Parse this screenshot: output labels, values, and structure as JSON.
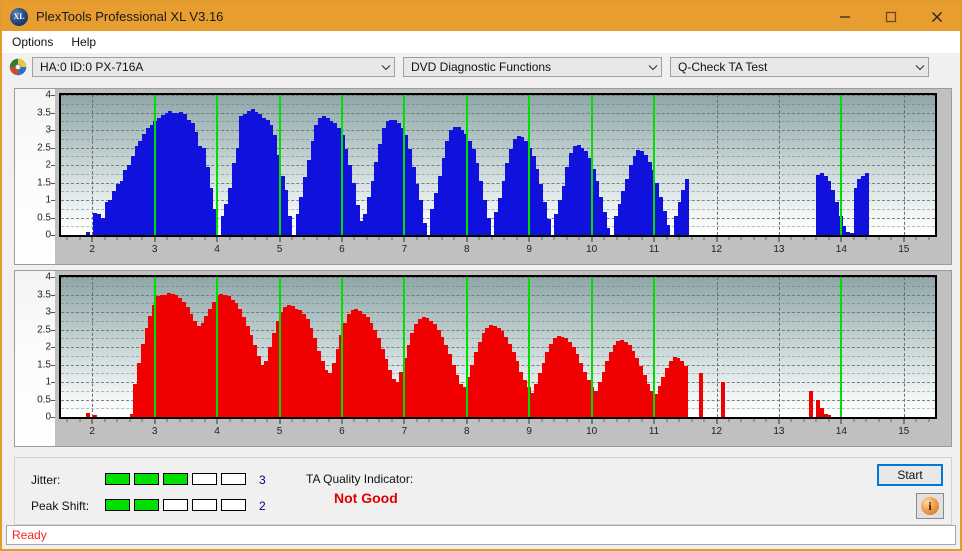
{
  "window": {
    "title": "PlexTools Professional XL V3.16",
    "icon": "XL",
    "controls": [
      {
        "name": "minimize",
        "glyph": "minimize-icon"
      },
      {
        "name": "maximize",
        "glyph": "maximize-icon"
      },
      {
        "name": "close",
        "glyph": "close-icon"
      }
    ],
    "titlebar_color": "#e89d31"
  },
  "menu": {
    "items": [
      {
        "label": "Options"
      },
      {
        "label": "Help"
      }
    ]
  },
  "toolbar": {
    "drive_icon": "disc-icon",
    "drive_select": {
      "value": "HA:0 ID:0  PX-716A",
      "arrow": "chevron-down-icon"
    },
    "function_select": {
      "value": "DVD Diagnostic Functions",
      "arrow": "chevron-down-icon"
    },
    "test_select": {
      "value": "Q-Check TA Test",
      "arrow": "chevron-down-icon"
    }
  },
  "results": {
    "jitter_label": "Jitter:",
    "jitter_value": "3",
    "jitter_filled": 3,
    "jitter_total": 5,
    "peak_shift_label": "Peak Shift:",
    "peak_shift_value": "2",
    "peak_shift_filled": 2,
    "peak_shift_total": 5,
    "ta_label": "TA Quality Indicator:",
    "ta_value": "Not Good",
    "ta_color": "#e00000",
    "meter_on_color": "#00e000",
    "start_label": "Start",
    "info_glyph": "i"
  },
  "status": {
    "text": "Ready",
    "color": "#ff2020"
  },
  "chart_data": [
    {
      "type": "bar",
      "name": "jitter-chart",
      "title": "",
      "xlabel": "",
      "ylabel": "",
      "xlim": [
        1.5,
        15.5
      ],
      "ylim": [
        0,
        4
      ],
      "ytick_labels": [
        "0",
        "0.5",
        "1",
        "1.5",
        "2",
        "2.5",
        "3",
        "3.5",
        "4"
      ],
      "ytick_values": [
        0,
        0.5,
        1,
        1.5,
        2,
        2.5,
        3,
        3.5,
        4
      ],
      "xtick_labels": [
        "2",
        "3",
        "4",
        "5",
        "6",
        "7",
        "8",
        "9",
        "10",
        "11",
        "12",
        "13",
        "14",
        "15"
      ],
      "xtick_values": [
        2,
        3,
        4,
        5,
        6,
        7,
        8,
        9,
        10,
        11,
        12,
        13,
        14,
        15
      ],
      "grid": true,
      "bar_color": "#1111dd",
      "green_gridlines": [
        3,
        4,
        5,
        6,
        7,
        8,
        9,
        10,
        11,
        14
      ],
      "gray_gridlines": [
        2,
        12,
        13,
        15
      ],
      "x": [
        1.93,
        1.99,
        2.05,
        2.11,
        2.17,
        2.23,
        2.29,
        2.35,
        2.41,
        2.47,
        2.53,
        2.59,
        2.65,
        2.71,
        2.77,
        2.83,
        2.89,
        2.95,
        3.01,
        3.07,
        3.13,
        3.19,
        3.25,
        3.31,
        3.37,
        3.43,
        3.49,
        3.55,
        3.61,
        3.67,
        3.73,
        3.79,
        3.85,
        3.91,
        3.97,
        4.03,
        4.09,
        4.15,
        4.21,
        4.27,
        4.33,
        4.39,
        4.45,
        4.51,
        4.57,
        4.63,
        4.69,
        4.75,
        4.81,
        4.87,
        4.93,
        4.99,
        5.05,
        5.11,
        5.17,
        5.23,
        5.29,
        5.35,
        5.41,
        5.47,
        5.53,
        5.59,
        5.65,
        5.71,
        5.77,
        5.83,
        5.89,
        5.95,
        6.01,
        6.07,
        6.13,
        6.19,
        6.25,
        6.31,
        6.37,
        6.43,
        6.49,
        6.55,
        6.61,
        6.67,
        6.73,
        6.79,
        6.85,
        6.91,
        6.97,
        7.03,
        7.09,
        7.15,
        7.21,
        7.27,
        7.33,
        7.39,
        7.45,
        7.51,
        7.57,
        7.63,
        7.69,
        7.75,
        7.81,
        7.87,
        7.93,
        7.99,
        8.05,
        8.11,
        8.17,
        8.23,
        8.29,
        8.35,
        8.41,
        8.47,
        8.53,
        8.59,
        8.65,
        8.71,
        8.77,
        8.83,
        8.89,
        8.95,
        9.01,
        9.07,
        9.13,
        9.19,
        9.25,
        9.31,
        9.37,
        9.43,
        9.49,
        9.55,
        9.61,
        9.67,
        9.73,
        9.79,
        9.85,
        9.91,
        9.97,
        10.03,
        10.09,
        10.15,
        10.21,
        10.27,
        10.33,
        10.39,
        10.45,
        10.51,
        10.57,
        10.63,
        10.69,
        10.75,
        10.81,
        10.87,
        10.93,
        10.99,
        11.05,
        11.11,
        11.17,
        11.23,
        11.29,
        11.35,
        11.41,
        11.47,
        11.53,
        13.63,
        13.69,
        13.75,
        13.81,
        13.87,
        13.93,
        13.99,
        14.05,
        14.11,
        14.17,
        14.23,
        14.29,
        14.35,
        14.41
      ],
      "values": [
        0.1,
        0.0,
        0.62,
        0.6,
        0.5,
        0.95,
        1.0,
        1.25,
        1.45,
        1.55,
        1.85,
        2.0,
        2.25,
        2.55,
        2.7,
        2.9,
        3.05,
        3.15,
        3.25,
        3.35,
        3.42,
        3.5,
        3.55,
        3.5,
        3.5,
        3.52,
        3.45,
        3.3,
        3.2,
        2.95,
        2.55,
        2.5,
        1.95,
        1.35,
        0.75,
        0.0,
        0.55,
        0.9,
        1.35,
        2.05,
        2.5,
        3.4,
        3.45,
        3.55,
        3.6,
        3.52,
        3.45,
        3.35,
        3.3,
        3.15,
        2.85,
        2.3,
        1.7,
        1.3,
        0.55,
        0.0,
        0.6,
        1.1,
        1.65,
        2.15,
        2.7,
        3.15,
        3.35,
        3.4,
        3.35,
        3.25,
        3.2,
        3.05,
        2.85,
        2.45,
        2.0,
        1.5,
        0.85,
        0.4,
        0.6,
        1.1,
        1.55,
        2.1,
        2.6,
        3.05,
        3.25,
        3.3,
        3.28,
        3.2,
        3.05,
        2.85,
        2.45,
        1.95,
        1.45,
        1.0,
        0.35,
        0.0,
        0.75,
        1.2,
        1.7,
        2.2,
        2.7,
        3.0,
        3.1,
        3.08,
        3.0,
        2.9,
        2.7,
        2.45,
        2.05,
        1.55,
        1.0,
        0.5,
        0.0,
        0.65,
        1.05,
        1.55,
        2.05,
        2.45,
        2.75,
        2.82,
        2.8,
        2.7,
        2.5,
        2.25,
        1.9,
        1.45,
        0.95,
        0.45,
        0.0,
        0.6,
        1.0,
        1.4,
        1.95,
        2.35,
        2.55,
        2.58,
        2.5,
        2.4,
        2.2,
        1.9,
        1.55,
        1.1,
        0.65,
        0.2,
        0.0,
        0.55,
        0.9,
        1.25,
        1.6,
        2.0,
        2.25,
        2.42,
        2.4,
        2.3,
        2.1,
        1.85,
        1.5,
        1.1,
        0.7,
        0.3,
        0.0,
        0.55,
        0.95,
        1.3,
        1.6,
        1.72,
        1.78,
        1.7,
        1.55,
        1.3,
        0.95,
        0.55,
        0.25,
        0.1,
        0.05,
        1.35,
        1.6,
        1.7,
        1.78,
        1.7,
        1.55,
        1.3,
        1.05,
        0.8
      ]
    },
    {
      "type": "bar",
      "name": "peak-shift-chart",
      "title": "",
      "xlabel": "",
      "ylabel": "",
      "xlim": [
        1.5,
        15.5
      ],
      "ylim": [
        0,
        4
      ],
      "ytick_labels": [
        "0",
        "0.5",
        "1",
        "1.5",
        "2",
        "2.5",
        "3",
        "3.5",
        "4"
      ],
      "ytick_values": [
        0,
        0.5,
        1,
        1.5,
        2,
        2.5,
        3,
        3.5,
        4
      ],
      "xtick_labels": [
        "2",
        "3",
        "4",
        "5",
        "6",
        "7",
        "8",
        "9",
        "10",
        "11",
        "12",
        "13",
        "14",
        "15"
      ],
      "xtick_values": [
        2,
        3,
        4,
        5,
        6,
        7,
        8,
        9,
        10,
        11,
        12,
        13,
        14,
        15
      ],
      "grid": true,
      "bar_color": "#f00000",
      "green_gridlines": [
        3,
        4,
        5,
        6,
        7,
        8,
        9,
        10,
        11,
        14
      ],
      "gray_gridlines": [
        2,
        12,
        13,
        15
      ],
      "x": [
        1.93,
        2.05,
        2.63,
        2.69,
        2.75,
        2.81,
        2.87,
        2.93,
        2.99,
        3.05,
        3.11,
        3.17,
        3.23,
        3.29,
        3.35,
        3.41,
        3.47,
        3.53,
        3.59,
        3.65,
        3.71,
        3.77,
        3.83,
        3.89,
        3.95,
        4.01,
        4.07,
        4.13,
        4.19,
        4.25,
        4.31,
        4.37,
        4.43,
        4.49,
        4.55,
        4.61,
        4.67,
        4.73,
        4.79,
        4.85,
        4.91,
        4.97,
        5.03,
        5.09,
        5.15,
        5.21,
        5.27,
        5.33,
        5.39,
        5.45,
        5.51,
        5.57,
        5.63,
        5.69,
        5.75,
        5.81,
        5.87,
        5.93,
        5.99,
        6.05,
        6.11,
        6.17,
        6.23,
        6.29,
        6.35,
        6.41,
        6.47,
        6.53,
        6.59,
        6.65,
        6.71,
        6.77,
        6.83,
        6.89,
        6.95,
        7.01,
        7.07,
        7.13,
        7.19,
        7.25,
        7.31,
        7.37,
        7.43,
        7.49,
        7.55,
        7.61,
        7.67,
        7.73,
        7.79,
        7.85,
        7.91,
        7.97,
        8.03,
        8.09,
        8.15,
        8.21,
        8.27,
        8.33,
        8.39,
        8.45,
        8.51,
        8.57,
        8.63,
        8.69,
        8.75,
        8.81,
        8.87,
        8.93,
        8.99,
        9.05,
        9.11,
        9.17,
        9.23,
        9.29,
        9.35,
        9.41,
        9.47,
        9.53,
        9.59,
        9.65,
        9.71,
        9.77,
        9.83,
        9.89,
        9.95,
        10.01,
        10.07,
        10.13,
        10.19,
        10.25,
        10.31,
        10.37,
        10.43,
        10.49,
        10.55,
        10.61,
        10.67,
        10.73,
        10.79,
        10.85,
        10.91,
        10.97,
        11.03,
        11.09,
        11.15,
        11.21,
        11.27,
        11.33,
        11.39,
        11.45,
        11.51,
        11.75,
        12.1,
        13.51,
        13.63,
        13.69,
        13.75,
        13.81,
        13.87,
        13.93,
        13.99,
        14.05,
        14.11,
        14.17,
        14.23,
        14.29,
        14.41,
        14.53
      ],
      "values": [
        0.12,
        0.05,
        0.1,
        0.95,
        1.55,
        2.1,
        2.55,
        2.9,
        3.2,
        3.45,
        3.5,
        3.48,
        3.55,
        3.52,
        3.48,
        3.4,
        3.3,
        3.15,
        2.95,
        2.75,
        2.6,
        2.7,
        2.9,
        3.1,
        3.3,
        3.5,
        3.52,
        3.5,
        3.45,
        3.35,
        3.25,
        3.1,
        2.85,
        2.6,
        2.35,
        2.05,
        1.75,
        1.5,
        1.6,
        2.0,
        2.4,
        2.75,
        3.0,
        3.15,
        3.2,
        3.18,
        3.1,
        3.05,
        2.95,
        2.8,
        2.55,
        2.25,
        1.9,
        1.6,
        1.35,
        1.25,
        1.55,
        1.95,
        2.35,
        2.7,
        2.95,
        3.05,
        3.08,
        3.02,
        2.95,
        2.85,
        2.7,
        2.5,
        2.25,
        1.95,
        1.65,
        1.35,
        1.1,
        1.0,
        1.3,
        1.7,
        2.05,
        2.4,
        2.65,
        2.8,
        2.85,
        2.82,
        2.75,
        2.65,
        2.5,
        2.3,
        2.05,
        1.8,
        1.5,
        1.2,
        0.95,
        0.85,
        1.15,
        1.5,
        1.85,
        2.15,
        2.4,
        2.55,
        2.62,
        2.6,
        2.55,
        2.45,
        2.3,
        2.1,
        1.85,
        1.6,
        1.3,
        1.05,
        0.85,
        0.7,
        0.95,
        1.25,
        1.55,
        1.85,
        2.1,
        2.25,
        2.32,
        2.3,
        2.25,
        2.15,
        2.0,
        1.8,
        1.55,
        1.3,
        1.05,
        0.85,
        0.75,
        1.0,
        1.3,
        1.6,
        1.85,
        2.05,
        2.18,
        2.2,
        2.15,
        2.05,
        1.9,
        1.7,
        1.45,
        1.2,
        0.95,
        0.75,
        0.65,
        0.9,
        1.15,
        1.4,
        1.6,
        1.72,
        1.7,
        1.6,
        1.45,
        1.25,
        1.0,
        0.75,
        0.5,
        0.25,
        0.1,
        0.05,
        0.0,
        0.0,
        0.0,
        0.0,
        0.0,
        0.0,
        0.0,
        0.0
      ]
    }
  ]
}
